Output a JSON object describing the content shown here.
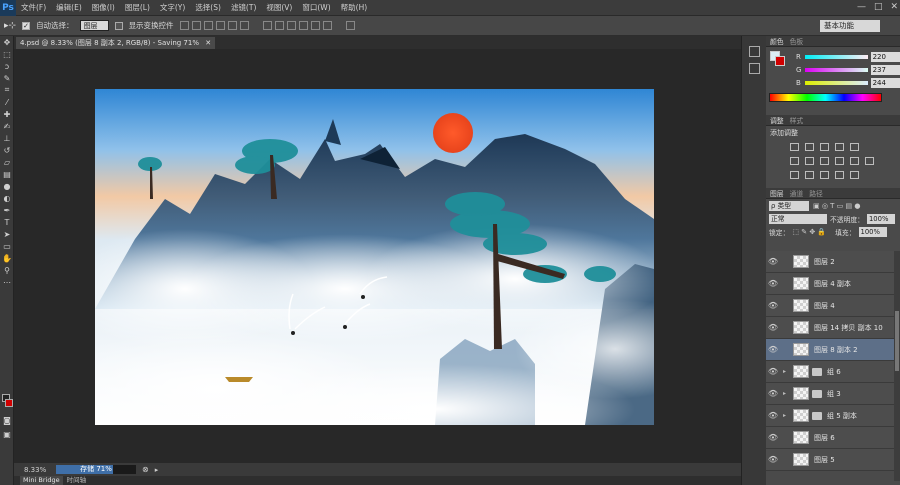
{
  "app": {
    "logo": "Ps"
  },
  "menu": [
    "文件(F)",
    "编辑(E)",
    "图像(I)",
    "图层(L)",
    "文字(Y)",
    "选择(S)",
    "滤镜(T)",
    "视图(V)",
    "窗口(W)",
    "帮助(H)"
  ],
  "options": {
    "auto_select_label": "自动选择：",
    "auto_select_value": "图层",
    "show_transform_label": "显示变换控件",
    "workspace": "基本功能"
  },
  "document": {
    "tab_title": "4.psd @ 8.33% (图层 8 副本 2, RGB/8) - Saving 71%",
    "zoom": "8.33%"
  },
  "status": {
    "saving_text": "存储 71%",
    "saving_progress": 0.71
  },
  "bottom_tabs": [
    "Mini Bridge",
    "时间轴"
  ],
  "color_panel": {
    "tabs": [
      "颜色",
      "色板"
    ],
    "r_label": "R",
    "g_label": "G",
    "b_label": "B",
    "r": "220",
    "g": "237",
    "b": "244",
    "fg_color": "#dcedf4",
    "bg_color": "#d00000"
  },
  "adjust_panel": {
    "tabs": [
      "调整",
      "样式"
    ],
    "add_label": "添加调整"
  },
  "layers_panel": {
    "tabs": [
      "图层",
      "通道",
      "路径"
    ],
    "filter_kind": "ρ 类型",
    "blend_mode": "正常",
    "opacity_label": "不透明度：",
    "opacity": "100%",
    "lock_label": "锁定：",
    "fill_label": "填充：",
    "fill": "100%",
    "layers": [
      {
        "name": "图层 2",
        "type": "layer"
      },
      {
        "name": "图层 4 副本",
        "type": "layer"
      },
      {
        "name": "图层 4",
        "type": "layer"
      },
      {
        "name": "图层 14 拷贝 副本 10",
        "type": "layer"
      },
      {
        "name": "图层 8 副本 2",
        "type": "layer",
        "selected": true
      },
      {
        "name": "组 6",
        "type": "group"
      },
      {
        "name": "组 3",
        "type": "group"
      },
      {
        "name": "组 5 副本",
        "type": "group"
      },
      {
        "name": "图层 6",
        "type": "layer"
      },
      {
        "name": "图层 5",
        "type": "layer"
      }
    ]
  }
}
